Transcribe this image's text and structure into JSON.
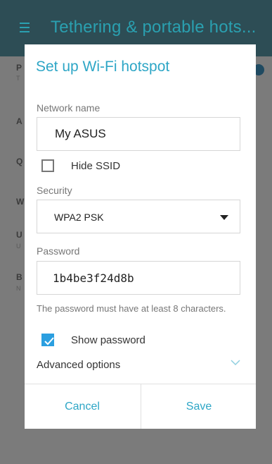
{
  "background": {
    "app_title": "Tethering & portable hots...",
    "row_letters": [
      "P",
      "T",
      "A",
      "Q",
      "W",
      "U",
      "U",
      "B",
      "N"
    ]
  },
  "dialog": {
    "title": "Set up Wi-Fi hotspot",
    "network_name_label": "Network name",
    "network_name_value": "My ASUS",
    "hide_ssid_label": "Hide SSID",
    "hide_ssid_checked": false,
    "security_label": "Security",
    "security_value": "WPA2 PSK",
    "password_label": "Password",
    "password_value": "1b4be3f24d8b",
    "password_hint": "The password must have at least 8 characters.",
    "show_password_label": "Show password",
    "show_password_checked": true,
    "advanced_label": "Advanced options",
    "cancel_label": "Cancel",
    "save_label": "Save"
  },
  "colors": {
    "accent": "#2ea6c6",
    "checkbox_checked": "#2b9fe0",
    "scrim_bg": "#7b7b7b"
  }
}
